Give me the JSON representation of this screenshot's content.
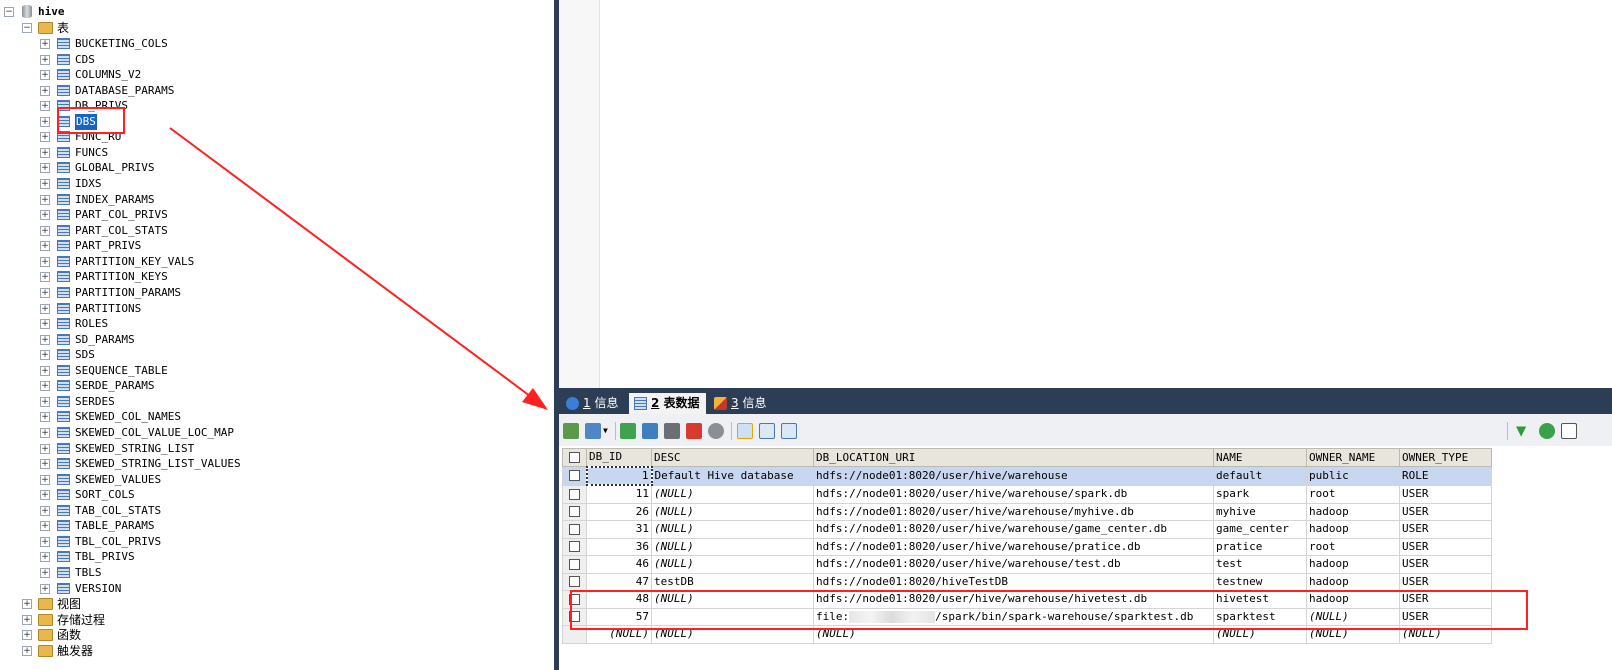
{
  "tree": {
    "db_name": "hive",
    "tables_folder": "表",
    "tables": [
      "BUCKETING_COLS",
      "CDS",
      "COLUMNS_V2",
      "DATABASE_PARAMS",
      "DB_PRIVS",
      "DBS",
      "FUNC_RU",
      "FUNCS",
      "GLOBAL_PRIVS",
      "IDXS",
      "INDEX_PARAMS",
      "PART_COL_PRIVS",
      "PART_COL_STATS",
      "PART_PRIVS",
      "PARTITION_KEY_VALS",
      "PARTITION_KEYS",
      "PARTITION_PARAMS",
      "PARTITIONS",
      "ROLES",
      "SD_PARAMS",
      "SDS",
      "SEQUENCE_TABLE",
      "SERDE_PARAMS",
      "SERDES",
      "SKEWED_COL_NAMES",
      "SKEWED_COL_VALUE_LOC_MAP",
      "SKEWED_STRING_LIST",
      "SKEWED_STRING_LIST_VALUES",
      "SKEWED_VALUES",
      "SORT_COLS",
      "TAB_COL_STATS",
      "TABLE_PARAMS",
      "TBL_COL_PRIVS",
      "TBL_PRIVS",
      "TBLS",
      "VERSION"
    ],
    "selected_table": "DBS",
    "folders": [
      "视图",
      "存储过程",
      "函数",
      "触发器"
    ]
  },
  "tabs": [
    {
      "num": "1",
      "label": "信息"
    },
    {
      "num": "2",
      "label": "表数据"
    },
    {
      "num": "3",
      "label": "信息"
    }
  ],
  "grid": {
    "columns": [
      "DB_ID",
      "DESC",
      "DB_LOCATION_URI",
      "NAME",
      "OWNER_NAME",
      "OWNER_TYPE"
    ],
    "rows": [
      [
        "1",
        "Default Hive database",
        "hdfs://node01:8020/user/hive/warehouse",
        "default",
        "public",
        "ROLE"
      ],
      [
        "11",
        "(NULL)",
        "hdfs://node01:8020/user/hive/warehouse/spark.db",
        "spark",
        "root",
        "USER"
      ],
      [
        "26",
        "(NULL)",
        "hdfs://node01:8020/user/hive/warehouse/myhive.db",
        "myhive",
        "hadoop",
        "USER"
      ],
      [
        "31",
        "(NULL)",
        "hdfs://node01:8020/user/hive/warehouse/game_center.db",
        "game_center",
        "hadoop",
        "USER"
      ],
      [
        "36",
        "(NULL)",
        "hdfs://node01:8020/user/hive/warehouse/pratice.db",
        "pratice",
        "root",
        "USER"
      ],
      [
        "46",
        "(NULL)",
        "hdfs://node01:8020/user/hive/warehouse/test.db",
        "test",
        "hadoop",
        "USER"
      ],
      [
        "47",
        "testDB",
        "hdfs://node01:8020/hiveTestDB",
        "testnew",
        "hadoop",
        "USER"
      ],
      [
        "48",
        "(NULL)",
        "hdfs://node01:8020/user/hive/warehouse/hivetest.db",
        "hivetest",
        "hadoop",
        "USER"
      ],
      [
        "57",
        "",
        "file:",
        "sparktest",
        "(NULL)",
        "USER"
      ],
      [
        "(NULL)",
        "(NULL)",
        "(NULL)",
        "(NULL)",
        "(NULL)",
        "(NULL)"
      ]
    ],
    "row57_uri_suffix": "/spark/bin/spark-warehouse/sparktest.db"
  },
  "colors": {
    "annotation": "#ff2020",
    "selection": "#1664c4",
    "tabbar": "#2c3e56"
  }
}
